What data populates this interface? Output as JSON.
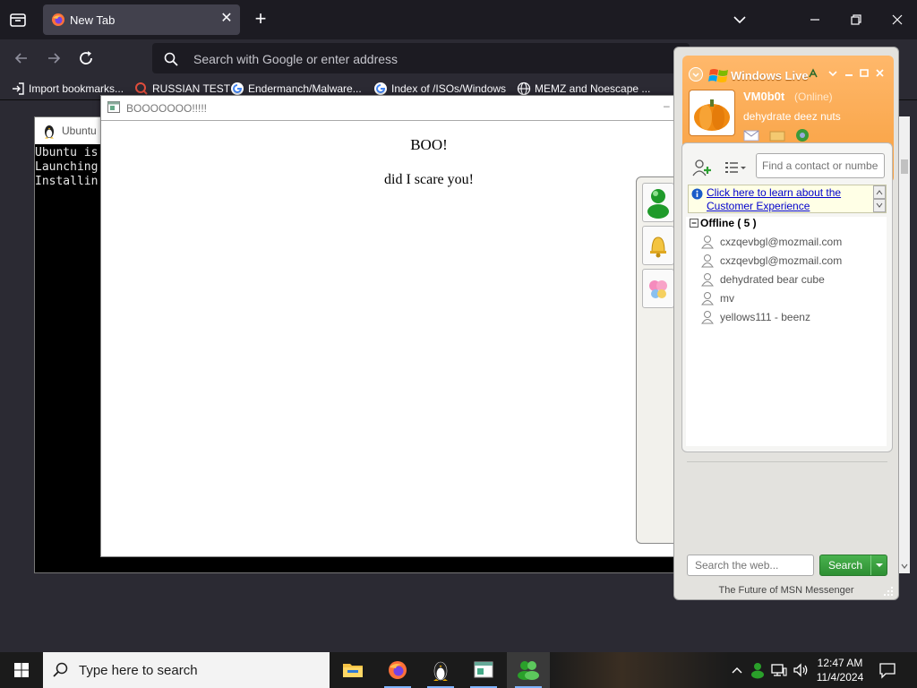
{
  "browser": {
    "tab_title": "New Tab",
    "tab_close": "✕",
    "new_tab": "+",
    "url_placeholder": "Search with Google or enter address",
    "bookmarks": [
      {
        "label": "Import bookmarks...",
        "icon": "import-icon"
      },
      {
        "label": "RUSSIAN TEST",
        "icon": "search-icon"
      },
      {
        "label": "Endermanch/Malware...",
        "icon": "google-icon"
      },
      {
        "label": "Index of /ISOs/Windows",
        "icon": "google-icon"
      },
      {
        "label": "MEMZ and Noescape ...",
        "icon": "globe-icon"
      }
    ]
  },
  "terminal": {
    "tab_title": "Ubuntu",
    "lines": [
      "Ubuntu is",
      "Launching",
      "Installin"
    ]
  },
  "popup": {
    "title": "BOOOOOOO!!!!!",
    "heading": "BOO!",
    "message": "did I scare you!",
    "minimize": "–"
  },
  "messenger": {
    "brand": "Windows Live",
    "display_name": "VM0b0t",
    "status": "(Online)",
    "personal_message": "dehydrate deez nuts",
    "find_placeholder": "Find a contact or number",
    "banner_link": "Click here to learn about the Customer Experience",
    "group": {
      "name": "Offline ( 5 )",
      "expanded": true
    },
    "contacts": [
      "cxzqevbgl@mozmail.com",
      "cxzqevbgl@mozmail.com",
      "dehydrated bear cube",
      "mv",
      "yellows111 - beenz"
    ],
    "web_search_placeholder": "Search the web...",
    "search_button": "Search",
    "footer": "The Future of MSN Messenger",
    "accent": "#f79f3e"
  },
  "taskbar": {
    "search_placeholder": "Type here to search",
    "time": "12:47 AM",
    "date": "11/4/2024",
    "apps": [
      "file-explorer-icon",
      "firefox-icon",
      "tux-icon",
      "window-app-icon",
      "msn-messenger-icon"
    ]
  }
}
